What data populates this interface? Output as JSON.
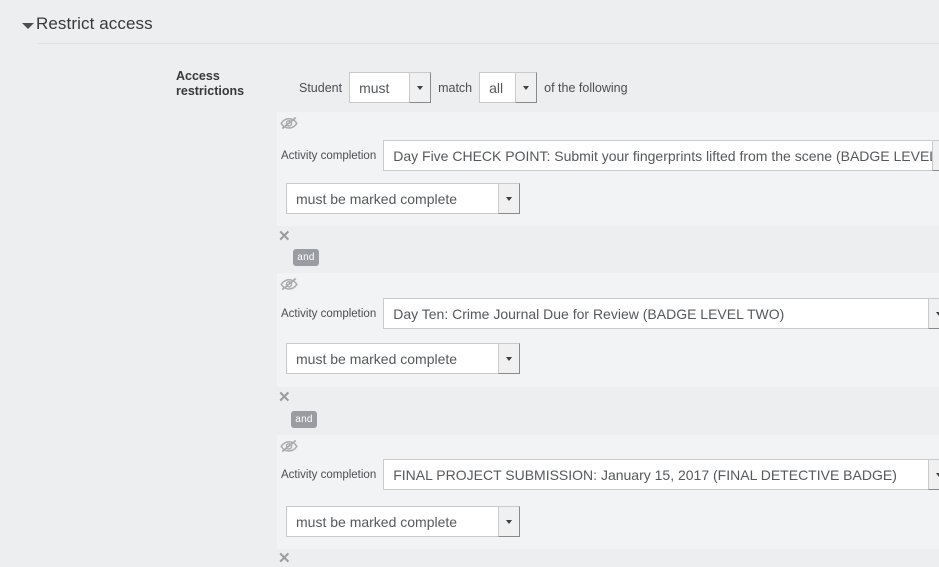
{
  "section": {
    "title": "Restrict access",
    "collapse_icon": "chevron-down-icon"
  },
  "form": {
    "access_restrictions_label": "Access restrictions"
  },
  "condition_header": {
    "student_label": "Student",
    "operator_value": "must",
    "match_label": "match",
    "quantifier_value": "all",
    "suffix_label": "of the following"
  },
  "restrictions": [
    {
      "eye_icon": "eye-slash-icon",
      "label": "Activity completion",
      "activity_value": "Day Five CHECK POINT: Submit your fingerprints lifted from the scene (BADGE LEVEL ONE)",
      "requirement_value": "must be marked complete",
      "delete_icon": "close-icon"
    },
    {
      "eye_icon": "eye-slash-icon",
      "label": "Activity completion",
      "activity_value": "Day Ten: Crime Journal Due for Review (BADGE LEVEL TWO)",
      "requirement_value": "must be marked complete",
      "delete_icon": "close-icon"
    },
    {
      "eye_icon": "eye-slash-icon",
      "label": "Activity completion",
      "activity_value": "FINAL PROJECT SUBMISSION: January 15, 2017 (FINAL DETECTIVE BADGE)",
      "requirement_value": "must be marked complete",
      "delete_icon": "close-icon"
    }
  ],
  "operators": [
    {
      "label": "and"
    },
    {
      "label": "and"
    }
  ],
  "colors": {
    "page_background": "#eceeef",
    "block_background": "#f2f3f4",
    "text": "#4a4f54",
    "badge": "#999ca0",
    "border": "#c8cbcd"
  }
}
